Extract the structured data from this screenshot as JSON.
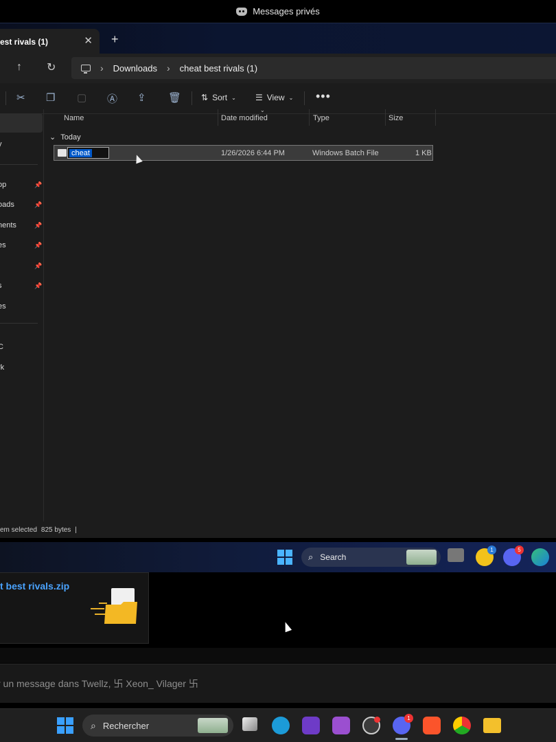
{
  "top_bar": {
    "title": "Messages privés"
  },
  "explorer": {
    "tab": {
      "label": "est rivals (1)",
      "close": "✕",
      "add": "+"
    },
    "breadcrumb": [
      "Downloads",
      "cheat best rivals (1)"
    ],
    "toolbar": {
      "sort_label": "Sort",
      "view_label": "View",
      "more": "•••"
    },
    "sidebar_items": [
      {
        "label": "y",
        "pinned": false
      },
      {
        "label": "op",
        "pinned": true
      },
      {
        "label": "oads",
        "pinned": true
      },
      {
        "label": "nents",
        "pinned": true
      },
      {
        "label": "es",
        "pinned": true
      },
      {
        "label": "",
        "pinned": true
      },
      {
        "label": "s",
        "pinned": true
      },
      {
        "label": "es",
        "pinned": false
      },
      {
        "label": "C",
        "pinned": false
      },
      {
        "label": "rk",
        "pinned": false
      }
    ],
    "columns": [
      "Name",
      "Date modified",
      "Type",
      "Size"
    ],
    "group_label": "Today",
    "files": [
      {
        "name": "cheat",
        "date": "1/26/2026 6:44 PM",
        "type": "Windows Batch File",
        "size": "1 KB"
      }
    ],
    "status": {
      "selection": "em selected",
      "bytes": "825 bytes",
      "divider": "|"
    }
  },
  "inner_taskbar": {
    "search_label": "Search",
    "badges": {
      "chat": "1",
      "discord": "5"
    }
  },
  "discord": {
    "attachment_name": "t best rivals.zip",
    "message_placeholder": "r un message dans Twellz, 卐 Xeon_ Vilager 卐"
  },
  "taskbar": {
    "search_label": "Rechercher",
    "discord_badge": "1"
  },
  "colors": {
    "accent": "#0058c8",
    "link": "#4aa3ff",
    "taskbar": "#202020"
  }
}
